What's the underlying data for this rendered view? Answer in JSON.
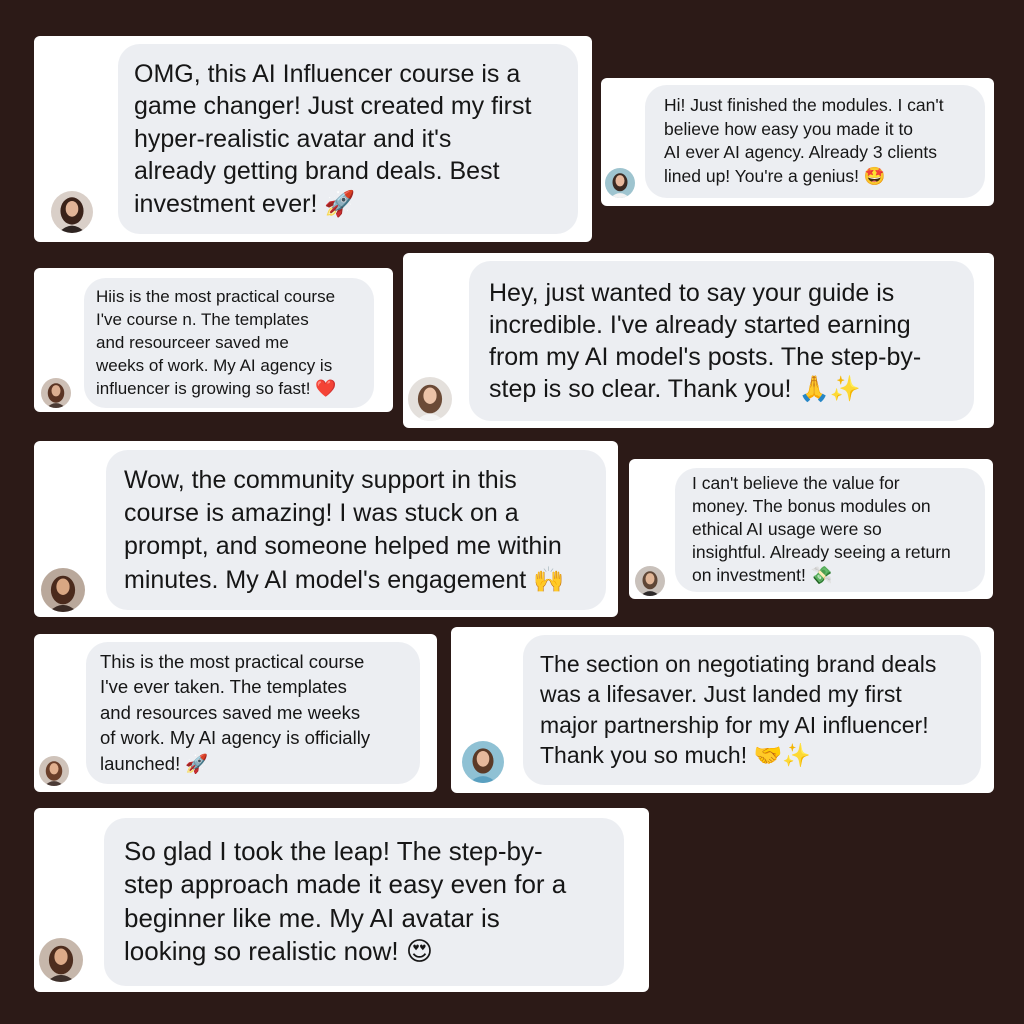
{
  "testimonials": [
    {
      "text": "OMG, this AI Influencer course is a\ngame changer! Just created my first\nhyper-realistic avatar and it's\nalready getting brand deals. Best\ninvestment ever!",
      "emoji": "🚀"
    },
    {
      "text": "Hi! Just finished the modules. I can't\nbelieve how easy you made it to\nAI ever  AI agency. Already 3 clients\nlined up! You're a genius!",
      "emoji": "🤩"
    },
    {
      "text": "Hiis is the most practical course\nI've course n. The templates\nand resourceer saved me\nweeks of work. My AI agency is\ninfluencer is growing so fast!",
      "emoji": "❤️"
    },
    {
      "text": "Hey, just wanted to say your guide is\nincredible. I've already started earning\nfrom my AI model's posts. The step-by-\nstep is so clear. Thank you!",
      "emoji": "🙏✨"
    },
    {
      "text": "Wow, the community support in this\ncourse is amazing! I was stuck on a\nprompt, and someone helped me within\nminutes. My AI model's engagement",
      "emoji": "🙌"
    },
    {
      "text": "I can't believe the value for\nmoney. The bonus modules on\nethical AI usage were so\ninsightful. Already seeing a return\non investment!",
      "emoji": "💸"
    },
    {
      "text": "This is the most practical course\nI've ever taken. The templates\nand resources saved me weeks\nof work. My AI agency is officially\nlaunched!",
      "emoji": "🚀"
    },
    {
      "text": "The section on negotiating brand deals\nwas a lifesaver. Just landed my first\nmajor partnership for my AI influencer!\nThank you so much!",
      "emoji": "🤝✨"
    },
    {
      "text": "So glad I took the leap! The step-by-\nstep approach made it easy even for a\nbeginner like me. My AI avatar is\nlooking so realistic now!",
      "emoji": "😍"
    }
  ],
  "colors": {
    "background": "#2c1a17",
    "card": "#ffffff",
    "bubble": "#eceef2",
    "text": "#161616"
  }
}
